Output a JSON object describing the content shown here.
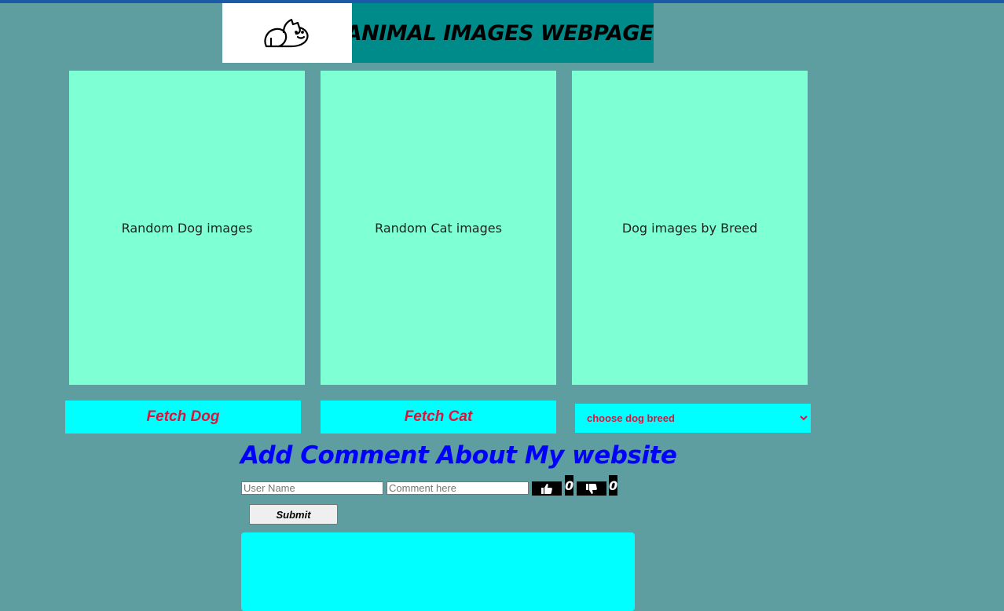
{
  "header": {
    "title": "ANIMAL IMAGES WEBPAGE",
    "logo_icon": "cat-dog-logo-icon"
  },
  "panels": [
    {
      "label": "Random Dog images"
    },
    {
      "label": "Random Cat images"
    },
    {
      "label": "Dog images by Breed"
    }
  ],
  "buttons": {
    "fetch_dog": "Fetch Dog",
    "fetch_cat": "Fetch Cat",
    "submit": "Submit"
  },
  "breed_select": {
    "selected": "choose dog breed"
  },
  "comments": {
    "title": "Add Comment About My website",
    "username_placeholder": "User Name",
    "comment_placeholder": "Comment here",
    "likes": "0",
    "dislikes": "0",
    "like_icon": "thumbs-up-icon",
    "dislike_icon": "thumbs-down-icon"
  },
  "colors": {
    "background": "#5f9ea0",
    "panel": "#7fffd4",
    "button": "#00ffff",
    "button_text": "#dc143c",
    "title_bg": "#008b8b",
    "comment_title": "#0000ff"
  }
}
